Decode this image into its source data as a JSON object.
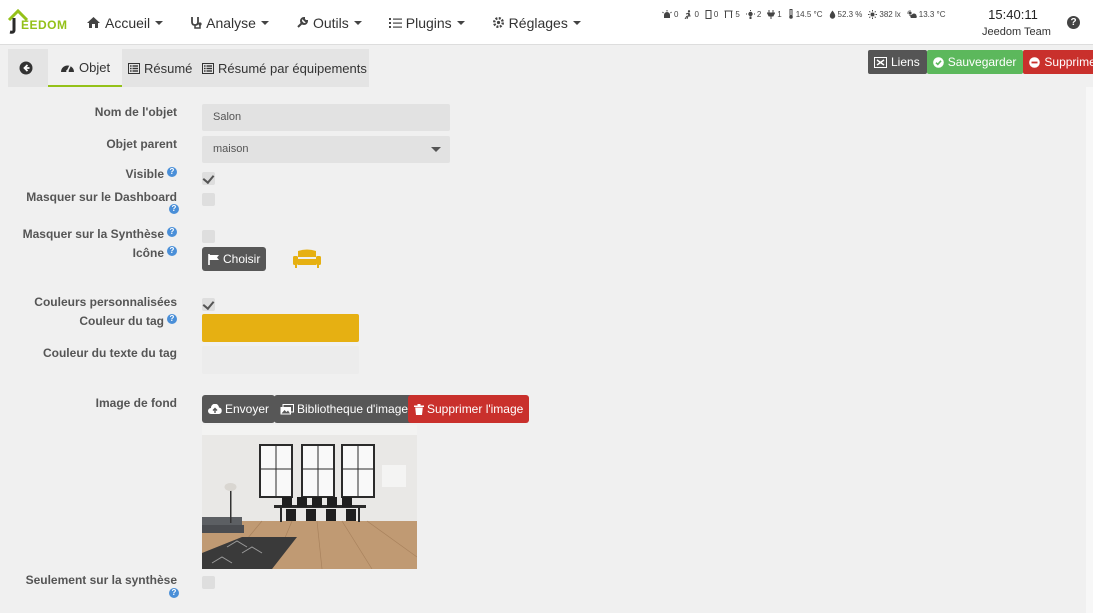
{
  "app": {
    "logo_text": "EEDOM",
    "logo_initial": "J"
  },
  "nav": {
    "items": [
      {
        "label": "Accueil",
        "icon": "home-icon"
      },
      {
        "label": "Analyse",
        "icon": "stethoscope-icon"
      },
      {
        "label": "Outils",
        "icon": "wrench-icon"
      },
      {
        "label": "Plugins",
        "icon": "tasks-icon"
      },
      {
        "label": "Réglages",
        "icon": "cog-icon"
      }
    ]
  },
  "status": [
    {
      "icon": "alarm-light-icon",
      "value": "0"
    },
    {
      "icon": "motion-icon",
      "value": "0"
    },
    {
      "icon": "door-icon",
      "value": "0"
    },
    {
      "icon": "window-icon",
      "value": "5"
    },
    {
      "icon": "light-icon",
      "value": "2"
    },
    {
      "icon": "plug-icon",
      "value": "1"
    },
    {
      "icon": "thermometer-icon",
      "value": "14.5 °C"
    },
    {
      "icon": "humidity-icon",
      "value": "52.3 %"
    },
    {
      "icon": "luminosity-icon",
      "value": "382 lx"
    },
    {
      "icon": "outdoor-temp-icon",
      "value": "13.3 °C"
    }
  ],
  "clock": {
    "time": "15:40:11",
    "user": "Jeedom Team"
  },
  "tabs": {
    "objet": "Objet",
    "resume": "Résumé",
    "resume_eq": "Résumé par équipements"
  },
  "actions": {
    "links": "Liens",
    "save": "Sauvegarder",
    "delete": "Supprimer"
  },
  "form": {
    "name_label": "Nom de l'objet",
    "name_value": "Salon",
    "parent_label": "Objet parent",
    "parent_value": "maison",
    "visible_label": "Visible",
    "hide_dashboard_label": "Masquer sur le Dashboard",
    "hide_synthese_label": "Masquer sur la Synthèse",
    "icon_label": "Icône",
    "choose_label": "Choisir",
    "custom_colors_label": "Couleurs personnalisées",
    "tag_color_label": "Couleur du tag",
    "tag_color": "#e6b012",
    "tag_text_color_label": "Couleur du texte du tag",
    "tag_text_color": "#ececec",
    "bg_image_label": "Image de fond",
    "upload_label": "Envoyer",
    "library_label": "Bibliotheque d'image",
    "remove_image_label": "Supprimer l'image",
    "only_synthese_label": "Seulement sur la synthèse"
  },
  "colors": {
    "accent": "#94c119",
    "save": "#5cb85c",
    "danger": "#c9302c",
    "dark_btn": "#575757",
    "help": "#4a8fd8"
  }
}
